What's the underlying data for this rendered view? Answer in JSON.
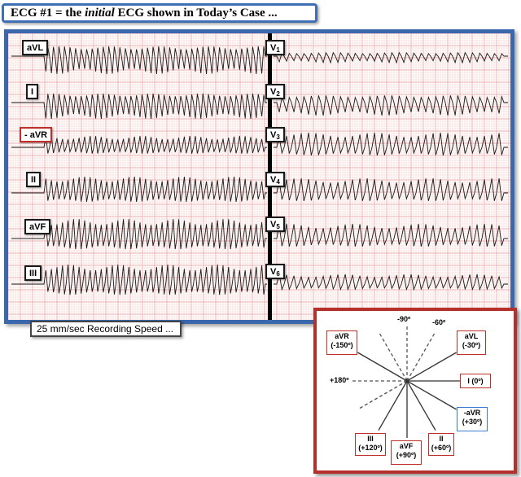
{
  "title": {
    "prefix": "ECG #1 = the ",
    "emph": "initial",
    "suffix": " ECG shown in Today’s Case ..."
  },
  "leads_left": [
    {
      "key": "aVL",
      "label": "aVL",
      "highlight": false
    },
    {
      "key": "I",
      "label": "I",
      "highlight": false
    },
    {
      "key": "neg-aVR",
      "label": "- aVR",
      "highlight": true
    },
    {
      "key": "II",
      "label": "II",
      "highlight": false
    },
    {
      "key": "aVF",
      "label": "aVF",
      "highlight": false
    },
    {
      "key": "III",
      "label": "III",
      "highlight": false
    }
  ],
  "leads_right": [
    {
      "key": "V1",
      "base": "V",
      "sub": "1"
    },
    {
      "key": "V2",
      "base": "V",
      "sub": "2"
    },
    {
      "key": "V3",
      "base": "V",
      "sub": "3"
    },
    {
      "key": "V4",
      "base": "V",
      "sub": "4"
    },
    {
      "key": "V5",
      "base": "V",
      "sub": "5"
    },
    {
      "key": "V6",
      "base": "V",
      "sub": "6"
    }
  ],
  "recording_speed": "25 mm/sec Recording Speed ...",
  "hexaxial": {
    "top_labels": {
      "minus90": "-90º",
      "minus60": "-60º",
      "plus180": "+180º"
    },
    "leads": {
      "aVR": {
        "name": "aVR",
        "angle": "(-150º)"
      },
      "aVL": {
        "name": "aVL",
        "angle": "(-30º)"
      },
      "I": {
        "name": "I (0º)"
      },
      "neg_aVR": {
        "name": "-aVR",
        "angle": "(+30º)"
      },
      "II": {
        "name": "II",
        "angle": "(+60º)"
      },
      "aVF": {
        "name": "aVF",
        "angle": "(+90º)"
      },
      "III": {
        "name": "III",
        "angle": "(+120º)"
      }
    }
  },
  "colors": {
    "frame_blue": "#3b68ad",
    "grid_minor": "#f4c9c9",
    "grid_major": "#e79a9a",
    "highlight_red": "#c0302b",
    "highlight_blue": "#3a7bd5"
  }
}
